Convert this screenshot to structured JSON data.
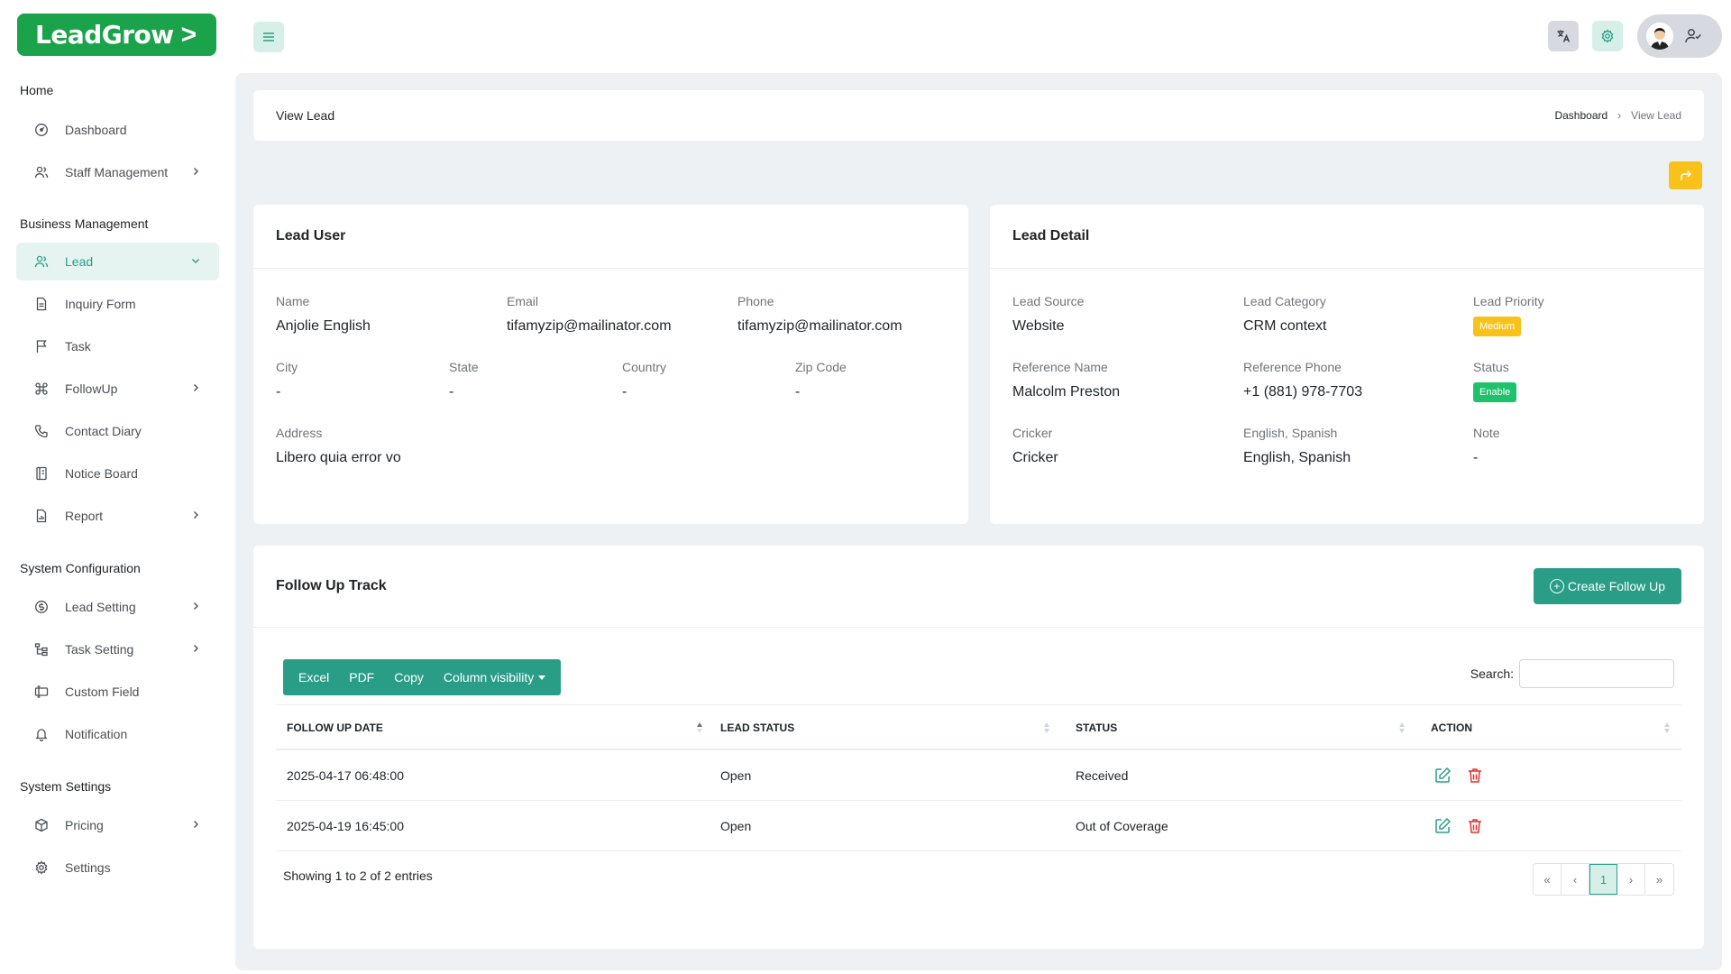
{
  "brand": {
    "name": "LeadGrow",
    "color": "#1aa34a"
  },
  "sidebar": {
    "sections": [
      {
        "title": "Home"
      },
      {
        "title": "Business Management"
      },
      {
        "title": "System Configuration"
      },
      {
        "title": "System Settings"
      }
    ],
    "items": [
      {
        "label": "Dashboard",
        "icon": "dashboard-icon"
      },
      {
        "label": "Staff Management",
        "icon": "users-icon"
      },
      {
        "label": "Lead",
        "icon": "users-icon",
        "active": true
      },
      {
        "label": "Inquiry Form",
        "icon": "document-icon"
      },
      {
        "label": "Task",
        "icon": "flag-icon"
      },
      {
        "label": "FollowUp",
        "icon": "command-icon"
      },
      {
        "label": "Contact Diary",
        "icon": "phone-icon"
      },
      {
        "label": "Notice Board",
        "icon": "notebook-icon"
      },
      {
        "label": "Report",
        "icon": "report-icon"
      },
      {
        "label": "Lead Setting",
        "icon": "coin-icon"
      },
      {
        "label": "Task Setting",
        "icon": "hierarchy-icon"
      },
      {
        "label": "Custom Field",
        "icon": "custom-field-icon"
      },
      {
        "label": "Notification",
        "icon": "bell-icon"
      },
      {
        "label": "Pricing",
        "icon": "box-icon"
      },
      {
        "label": "Settings",
        "icon": "gear-icon"
      }
    ]
  },
  "page": {
    "title": "View Lead",
    "breadcrumb": {
      "parent": "Dashboard",
      "current": "View Lead"
    }
  },
  "lead_user": {
    "title": "Lead User",
    "name": {
      "label": "Name",
      "value": "Anjolie English"
    },
    "email": {
      "label": "Email",
      "value": "tifamyzip@mailinator.com"
    },
    "phone": {
      "label": "Phone",
      "value": "tifamyzip@mailinator.com"
    },
    "city": {
      "label": "City",
      "value": "-"
    },
    "state": {
      "label": "State",
      "value": "-"
    },
    "country": {
      "label": "Country",
      "value": "-"
    },
    "zip": {
      "label": "Zip Code",
      "value": "-"
    },
    "address": {
      "label": "Address",
      "value": "Libero quia error vo"
    }
  },
  "lead_detail": {
    "title": "Lead Detail",
    "source": {
      "label": "Lead Source",
      "value": "Website"
    },
    "category": {
      "label": "Lead Category",
      "value": "CRM context"
    },
    "priority": {
      "label": "Lead Priority",
      "value": "Medium"
    },
    "ref_name": {
      "label": "Reference Name",
      "value": "Malcolm Preston"
    },
    "ref_phone": {
      "label": "Reference Phone",
      "value": "+1 (881) 978-7703"
    },
    "status": {
      "label": "Status",
      "value": "Enable"
    },
    "cricker": {
      "label": "Cricker",
      "value": "Cricker"
    },
    "languages": {
      "label": "English, Spanish",
      "value": "English, Spanish"
    },
    "note": {
      "label": "Note",
      "value": "-"
    }
  },
  "follow_up": {
    "title": "Follow Up Track",
    "create_label": "Create Follow Up",
    "export_buttons": {
      "excel": "Excel",
      "pdf": "PDF",
      "copy": "Copy",
      "colvis": "Column visibility"
    },
    "search_label": "Search:",
    "columns": {
      "date": "FOLLOW UP DATE",
      "lead_status": "LEAD STATUS",
      "status": "STATUS",
      "action": "ACTION"
    },
    "rows": [
      {
        "date": "2025-04-17 06:48:00",
        "lead_status": "Open",
        "status": "Received"
      },
      {
        "date": "2025-04-19 16:45:00",
        "lead_status": "Open",
        "status": "Out of Coverage"
      }
    ],
    "showing": "Showing 1 to 2 of 2 entries",
    "pagination": {
      "first": "«",
      "prev": "‹",
      "current": "1",
      "next": "›",
      "last": "»"
    }
  },
  "colors": {
    "primary": "#2a9d87",
    "warning": "#f9c21a",
    "success": "#1ec26b",
    "danger": "#e03131"
  }
}
